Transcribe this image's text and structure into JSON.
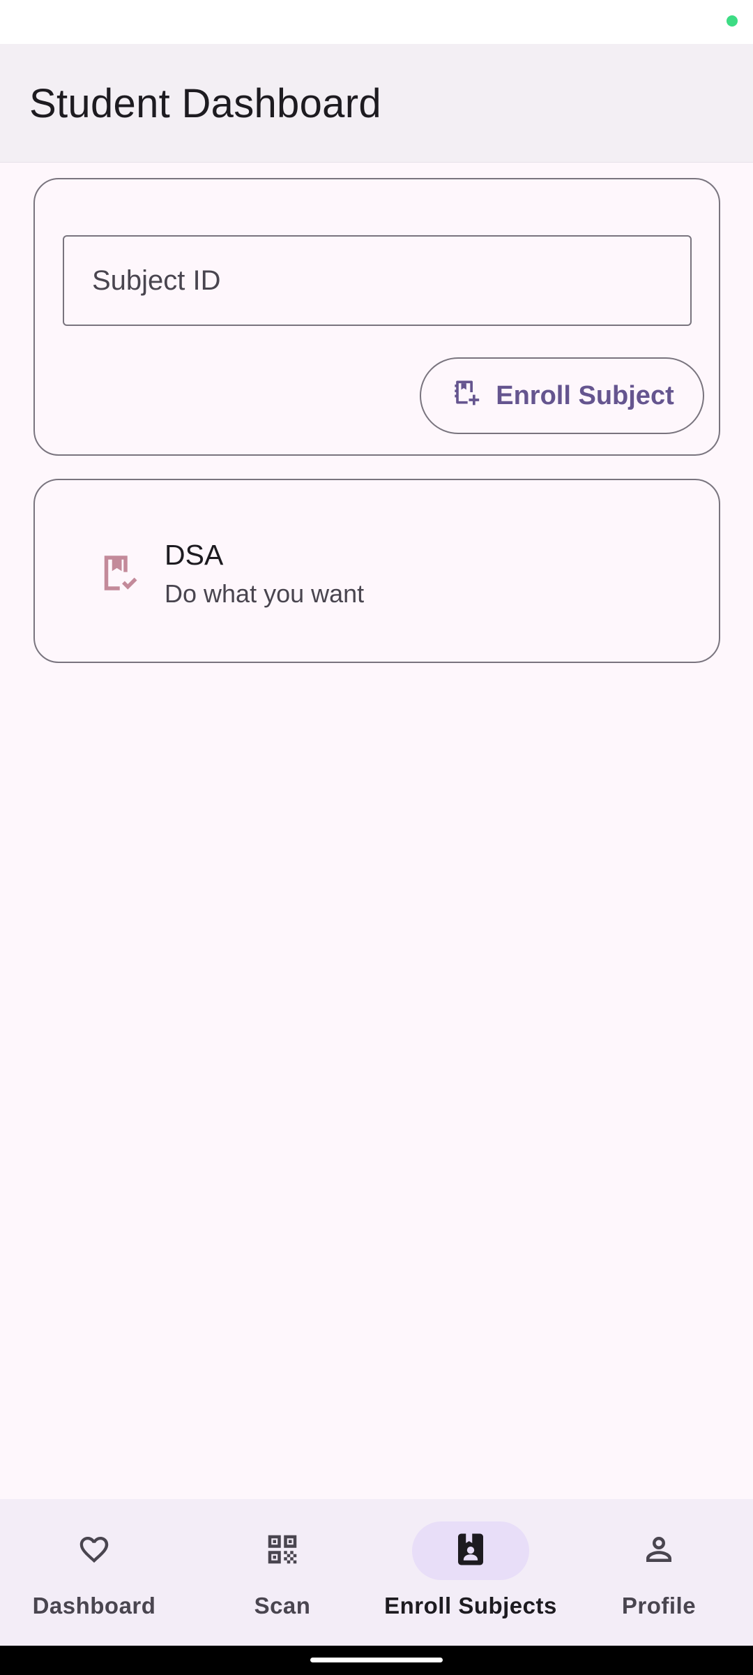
{
  "app": {
    "title": "Student Dashboard"
  },
  "enroll": {
    "subject_id_placeholder": "Subject ID",
    "subject_id_value": "",
    "button_label": "Enroll Subject",
    "button_icon": "book-add-icon"
  },
  "subjects": [
    {
      "name": "DSA",
      "description": "Do what you want",
      "icon": "bookmark-check-icon"
    }
  ],
  "bottom_nav": {
    "items": [
      {
        "label": "Dashboard",
        "icon": "heart-icon",
        "active": false
      },
      {
        "label": "Scan",
        "icon": "qr-code-icon",
        "active": false
      },
      {
        "label": "Enroll Subjects",
        "icon": "contact-book-icon",
        "active": true
      },
      {
        "label": "Profile",
        "icon": "person-icon",
        "active": false
      }
    ]
  },
  "colors": {
    "primary": "#65558F",
    "surface": "#FEF7FC",
    "app_bar": "#F3EFF4",
    "nav_bar": "#F3EDF7",
    "active_indicator": "#E8DEF8",
    "subject_icon": "#C38A9A",
    "status_dot": "#3DDC84"
  }
}
